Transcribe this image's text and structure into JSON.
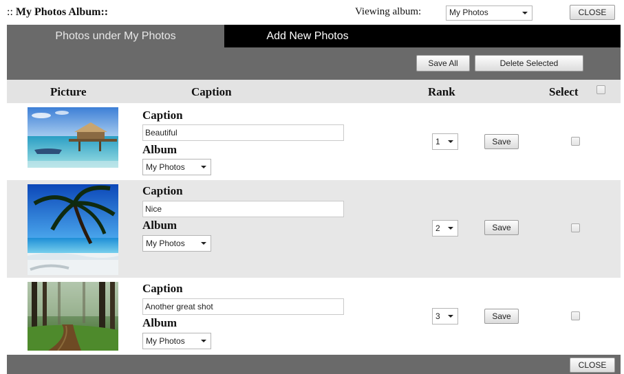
{
  "header": {
    "colons": "::",
    "title": "My Photos  Album::",
    "viewing_label": "Viewing album:",
    "viewing_value": "My Photos",
    "close_label": "CLOSE"
  },
  "tabs": [
    {
      "label": "Photos under My Photos",
      "active": true
    },
    {
      "label": "Add New Photos",
      "active": false
    }
  ],
  "toolbar": {
    "save_all": "Save All",
    "delete_selected": "Delete Selected"
  },
  "columns": {
    "picture": "Picture",
    "caption": "Caption",
    "rank": "Rank",
    "select": "Select"
  },
  "rows": [
    {
      "caption_label": "Caption",
      "caption_value": "Beautiful",
      "album_label": "Album",
      "album_value": "My Photos",
      "rank": "1",
      "save_label": "Save",
      "image": "beach-hut-photo"
    },
    {
      "caption_label": "Caption",
      "caption_value": "Nice",
      "album_label": "Album",
      "album_value": "My Photos",
      "rank": "2",
      "save_label": "Save",
      "image": "palm-tree-photo"
    },
    {
      "caption_label": "Caption",
      "caption_value": "Another great shot",
      "album_label": "Album",
      "album_value": "My Photos",
      "rank": "3",
      "save_label": "Save",
      "image": "forest-path-photo"
    }
  ],
  "footer": {
    "close_label": "CLOSE"
  },
  "colors": {
    "panel": "#6a6a6a",
    "tab_bar": "#000000",
    "header_row": "#e3e3e3",
    "alt_row": "#e7e7e7"
  }
}
